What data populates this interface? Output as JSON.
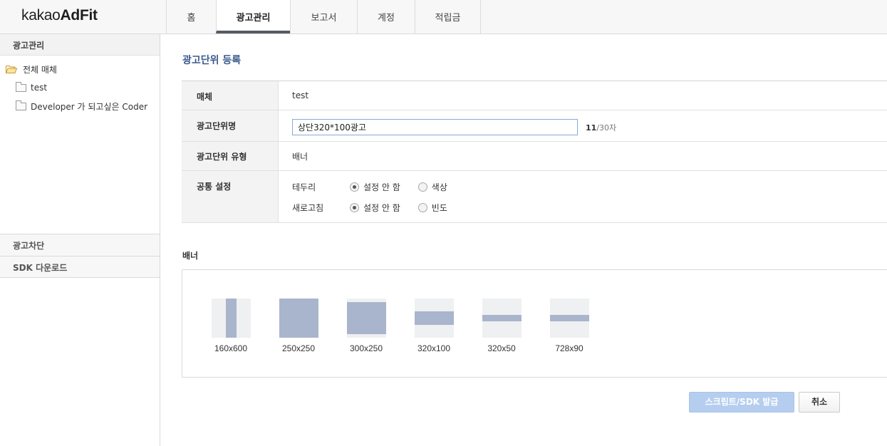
{
  "header": {
    "logo_prefix": "kakao",
    "logo_suffix": "AdFit",
    "nav": [
      {
        "label": "홈"
      },
      {
        "label": "광고관리"
      },
      {
        "label": "보고서"
      },
      {
        "label": "계정"
      },
      {
        "label": "적립금"
      }
    ],
    "active_nav": "광고관리"
  },
  "sidebar": {
    "section_title": "광고관리",
    "tree": {
      "root": "전체 매체",
      "children": [
        "test",
        "Developer 가 되고싶은 Coder"
      ]
    },
    "links": [
      "광고차단",
      "SDK 다운로드"
    ]
  },
  "main": {
    "title": "광고단위 등록",
    "form": {
      "media_label": "매체",
      "media_value": "test",
      "name_label": "광고단위명",
      "name_value": "상단320*100광고",
      "count_current": "11",
      "count_max": "/30자",
      "type_label": "광고단위 유형",
      "type_value": "배너",
      "common_label": "공통 설정",
      "border_label": "테두리",
      "border_options": [
        "설정 안 함",
        "색상"
      ],
      "border_selected": "설정 안 함",
      "refresh_label": "새로고침",
      "refresh_options": [
        "설정 안 함",
        "빈도"
      ],
      "refresh_selected": "설정 안 함"
    },
    "banner": {
      "title": "배너",
      "sizes": [
        "160x600",
        "250x250",
        "300x250",
        "320x100",
        "320x50",
        "728x90"
      ]
    },
    "buttons": {
      "issue": "스크립트/SDK 발급",
      "cancel": "취소"
    }
  },
  "colors": {
    "accent_title": "#3b5a8c",
    "thumb_fill": "#a9b5cc",
    "issue_button": "#b5cef0",
    "active_tab_bar": "#555b66"
  }
}
